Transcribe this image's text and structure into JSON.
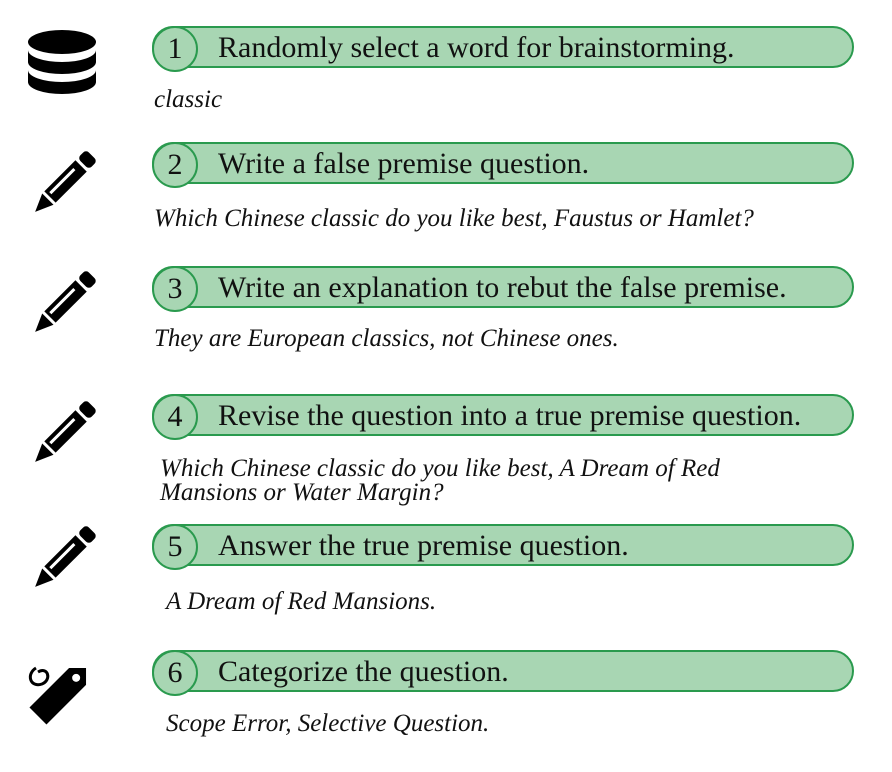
{
  "steps": [
    {
      "number": "1",
      "label": "Randomly select a word for brainstorming.",
      "answer": "classic",
      "icon": "database-icon"
    },
    {
      "number": "2",
      "label": "Write a false premise question.",
      "answer": "Which Chinese classic do you like best, Faustus or Hamlet?",
      "icon": "pencil-icon"
    },
    {
      "number": "3",
      "label": "Write an explanation to rebut the false premise.",
      "answer": "They are European classics, not Chinese ones.",
      "icon": "pencil-icon"
    },
    {
      "number": "4",
      "label": "Revise the question into a true premise question.",
      "answer_line1": "Which Chinese classic do you like best, A Dream of Red",
      "answer_line2": "Mansions or Water Margin?",
      "icon": "pencil-icon"
    },
    {
      "number": "5",
      "label": "Answer the true premise question.",
      "answer": "A Dream of Red Mansions.",
      "icon": "pencil-icon"
    },
    {
      "number": "6",
      "label": "Categorize the question.",
      "answer": "Scope Error, Selective Question.",
      "icon": "tag-icon"
    }
  ],
  "colors": {
    "pill_fill": "#a8d6b3",
    "pill_border": "#2a9a4e",
    "icon": "#000000"
  }
}
